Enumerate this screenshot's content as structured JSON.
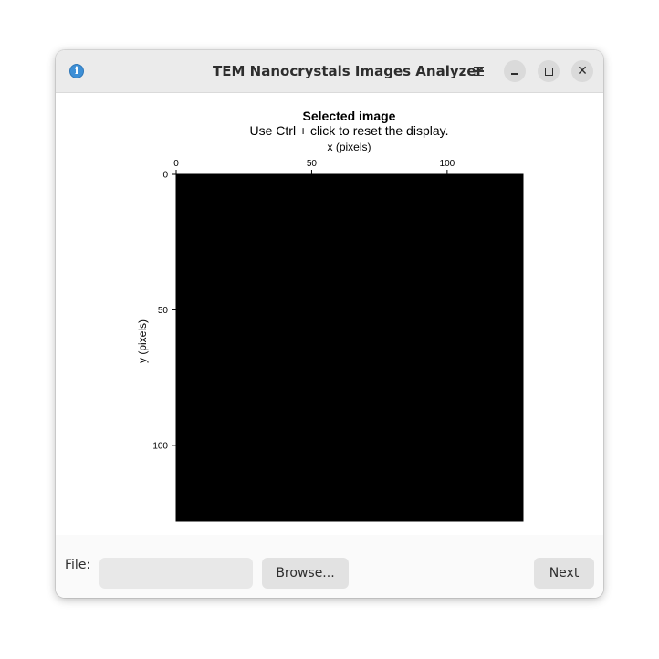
{
  "window": {
    "title": "TEM Nanocrystals Images Analyzer"
  },
  "plot": {
    "title": "Selected image",
    "subtitle": "Use Ctrl + click to reset the display.",
    "xlabel": "x (pixels)",
    "ylabel": "y (pixels)",
    "x_ticks": [
      "0",
      "50",
      "100"
    ],
    "y_ticks": [
      "0",
      "50",
      "100"
    ],
    "x_range": [
      0,
      128
    ],
    "y_range": [
      0,
      128
    ],
    "image_color": "#000000"
  },
  "footer": {
    "file_label": "File:",
    "file_value": "",
    "browse_label": "Browse...",
    "next_label": "Next"
  },
  "colors": {
    "accent": "#3d8fd6",
    "titlebar_bg": "#ebebeb",
    "button_bg": "#e2e2e2"
  }
}
